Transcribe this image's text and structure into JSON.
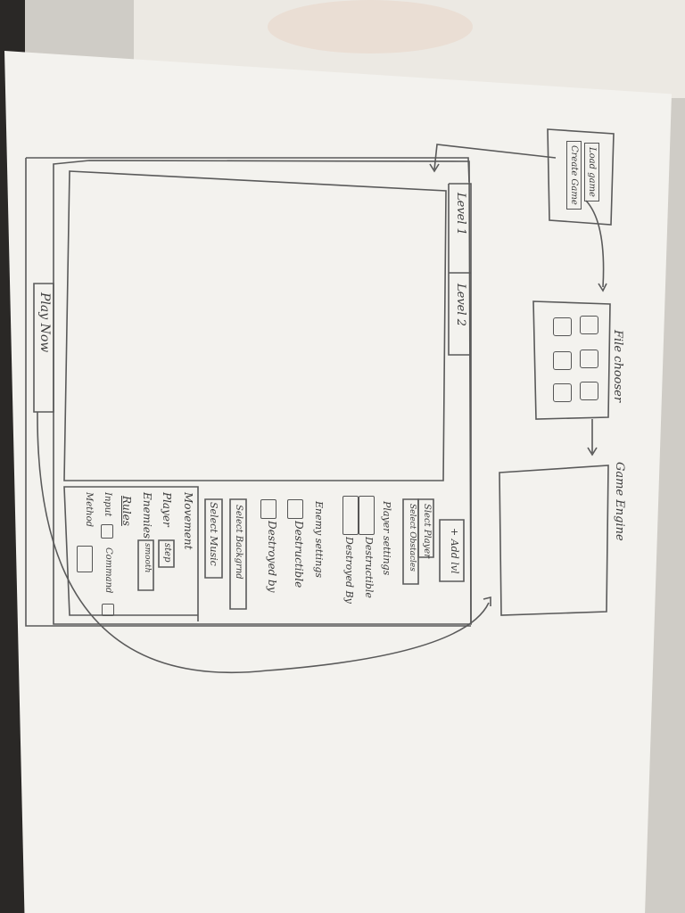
{
  "start_menu": {
    "load_game": "Load game",
    "create_game": "Create Game"
  },
  "file_chooser": {
    "label": "File chooser"
  },
  "game_engine": {
    "label": "Game Engine"
  },
  "editor": {
    "tabs": [
      "Level 1",
      "Level 2"
    ],
    "play_button": "Play Now",
    "add_button": "+ Add lvl",
    "select_player": "Slect Player",
    "select_obstacles": "Select Obstacles",
    "player_settings": {
      "title": "Player settings",
      "destructible": "Destructible",
      "destroyed_by": "Destroyed By"
    },
    "enemy_settings": {
      "title": "Enemy settings",
      "destructible": "Destructible",
      "destroyed_by": "Destroyed by"
    },
    "select_background": "Select Backgrnd",
    "select_music": "Select Music",
    "movement": {
      "title": "Movement",
      "player_label": "Player",
      "player_value": "step",
      "enemies_label": "Enemies",
      "enemies_value": "smooth",
      "rules_title": "Rules",
      "input_label": "Input",
      "method_label": "Method",
      "command_label": "Command"
    }
  }
}
